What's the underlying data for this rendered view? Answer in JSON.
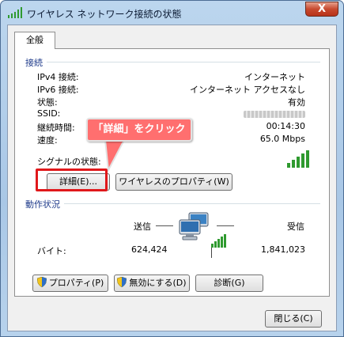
{
  "window": {
    "title": "ワイヤレス ネットワーク接続の状態",
    "close_label": "X"
  },
  "tabs": [
    {
      "label": "全般"
    }
  ],
  "connection": {
    "heading": "接続",
    "rows": [
      {
        "label": "IPv4 接続:",
        "value": "インターネット"
      },
      {
        "label": "IPv6 接続:",
        "value": "インターネット アクセスなし"
      },
      {
        "label": "状態:",
        "value": "有効"
      },
      {
        "label": "SSID:",
        "value": ""
      },
      {
        "label": "継続時間:",
        "value": "00:14:30"
      },
      {
        "label": "速度:",
        "value": "65.0 Mbps"
      }
    ],
    "signal_label": "シグナルの状態:",
    "signal_bars": 5,
    "details_button": "詳細(E)...",
    "wireless_props_button": "ワイヤレスのプロパティ(W)"
  },
  "callout": {
    "text": "「詳細」をクリック",
    "color": "#ff6f6f"
  },
  "activity": {
    "heading": "動作状況",
    "sent_label": "送信",
    "received_label": "受信",
    "bytes_label": "バイト:",
    "bytes_sent": "624,424",
    "bytes_received": "1,841,023"
  },
  "actions": {
    "properties_button": "プロパティ(P)",
    "disable_button": "無効にする(D)",
    "diagnose_button": "診断(G)"
  },
  "footer": {
    "close_button": "閉じる(C)"
  },
  "colors": {
    "accent": "#1e3a8a",
    "highlight": "#e0181b",
    "signal": "#2f9a2f"
  }
}
